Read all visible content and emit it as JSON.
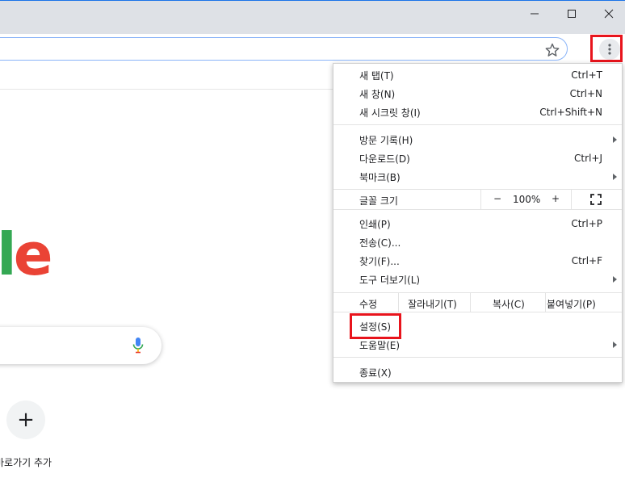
{
  "window": {
    "controls": [
      "minimize-icon",
      "maximize-icon",
      "close-icon"
    ]
  },
  "toolbar": {
    "star_icon": "star-icon",
    "menu_icon": "more-vert-icon"
  },
  "page": {
    "logo_letters": [
      "l",
      "e"
    ],
    "add_shortcut_symbol": "+",
    "add_shortcut_label": "바로가기 추가"
  },
  "menu": {
    "new_tab": {
      "label": "새 탭(T)",
      "shortcut": "Ctrl+T"
    },
    "new_window": {
      "label": "새 창(N)",
      "shortcut": "Ctrl+N"
    },
    "new_incognito": {
      "label": "새 시크릿 창(I)",
      "shortcut": "Ctrl+Shift+N"
    },
    "history": {
      "label": "방문 기록(H)"
    },
    "downloads": {
      "label": "다운로드(D)",
      "shortcut": "Ctrl+J"
    },
    "bookmarks": {
      "label": "북마크(B)"
    },
    "zoom": {
      "label": "글꼴 크기",
      "minus": "−",
      "value": "100%",
      "plus": "+"
    },
    "print": {
      "label": "인쇄(P)",
      "shortcut": "Ctrl+P"
    },
    "cast": {
      "label": "전송(C)..."
    },
    "find": {
      "label": "찾기(F)...",
      "shortcut": "Ctrl+F"
    },
    "more_tools": {
      "label": "도구 더보기(L)"
    },
    "edit": {
      "label": "수정",
      "cut": "잘라내기(T)",
      "copy": "복사(C)",
      "paste": "붙여넣기(P)"
    },
    "settings": {
      "label": "설정(S)"
    },
    "help": {
      "label": "도움말(E)"
    },
    "exit": {
      "label": "종료(X)"
    }
  },
  "colors": {
    "highlight": "#e8141c",
    "logo_green": "#34a853",
    "logo_red": "#ea4335",
    "titlebar": "#dee1e6"
  }
}
